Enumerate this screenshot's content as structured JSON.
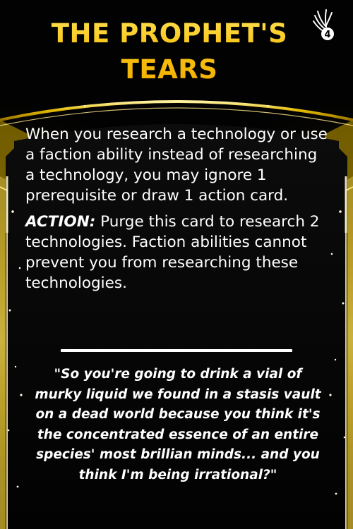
{
  "card": {
    "title_line1": "THE PROPHET'S",
    "title_line2": "TEARS",
    "badge_number": "4",
    "badge_icon": "winged-faction-emblem-icon",
    "ability_text": "When you research a technology or use a faction ability instead of researching a technology, you may ignore 1 prerequisite or draw 1 action card.",
    "action_label": "ACTION:",
    "action_text": " Purge this card to research 2 technologies. Faction abilities cannot prevent you from researching these technologies.",
    "flavor_text": "\"So you're going to drink a vial of murky liquid we found in a stasis vault on a dead world because you think it's the concentrated essence of an entire species' most brillian minds... and you think I'm being irrational?\""
  },
  "colors": {
    "title_gold": "#f5c518",
    "frame_gold": "#d9b200",
    "background": "#050505",
    "text": "#ffffff"
  }
}
